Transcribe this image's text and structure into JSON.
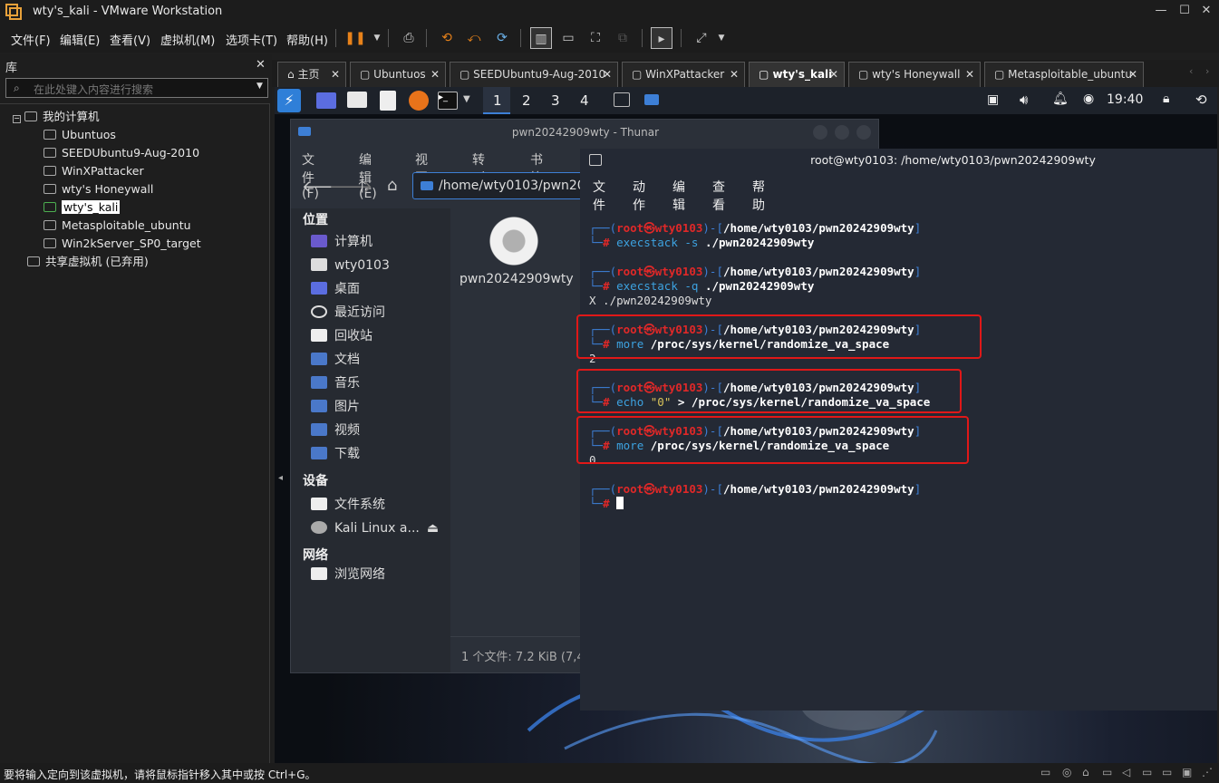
{
  "window": {
    "title": "wty's_kali - VMware Workstation",
    "min": "—",
    "max": "☐",
    "close": "✕"
  },
  "menubar": {
    "items": [
      "文件(F)",
      "编辑(E)",
      "查看(V)",
      "虚拟机(M)",
      "选项卡(T)",
      "帮助(H)"
    ]
  },
  "library": {
    "title": "库",
    "close": "✕",
    "search_placeholder": "在此处键入内容进行搜索",
    "root": "我的计算机",
    "vms": [
      "Ubuntuos",
      "SEEDUbuntu9-Aug-2010",
      "WinXPattacker",
      "wty's Honeywall",
      "wty's_kali",
      "Metasploitable_ubuntu",
      "Win2kServer_SP0_target"
    ],
    "selected": "wty's_kali",
    "shared": "共享虚拟机 (已弃用)"
  },
  "tabs": [
    {
      "label": "主页"
    },
    {
      "label": "Ubuntuos"
    },
    {
      "label": "SEEDUbuntu9-Aug-2010"
    },
    {
      "label": "WinXPattacker"
    },
    {
      "label": "wty's_kali",
      "active": true
    },
    {
      "label": "wty's Honeywall"
    },
    {
      "label": "Metasploitable_ubuntu"
    }
  ],
  "kali": {
    "workspaces": [
      "1",
      "2",
      "3",
      "4"
    ],
    "clock": "19:40",
    "desktop_icon": "Firefox ESR"
  },
  "thunar": {
    "title": "pwn20242909wty - Thunar",
    "menu": [
      "文件(F)",
      "编辑(E)",
      "视图(V)",
      "转到(G)",
      "书签(B)"
    ],
    "path": "/home/wty0103/pwn202",
    "sections": {
      "places": "位置",
      "devices": "设备",
      "network": "网络"
    },
    "places": [
      "计算机",
      "wty0103",
      "桌面",
      "最近访问",
      "回收站",
      "文档",
      "音乐",
      "图片",
      "视频",
      "下载"
    ],
    "devices": [
      "文件系统",
      "Kali Linux a..."
    ],
    "network_items": [
      "浏览网络"
    ],
    "file": "pwn20242909wty",
    "status": "1 个文件: 7.2 KiB (7,4"
  },
  "terminal": {
    "title": "root@wty0103: /home/wty0103/pwn20242909wty",
    "menu": [
      "文件",
      "动作",
      "编辑",
      "查看",
      "帮助"
    ],
    "user": "root",
    "host": "wty0103",
    "cwd": "/home/wty0103/pwn20242909wty",
    "blocks": [
      {
        "cmd": "execstack",
        "args": "-s",
        "target": "./pwn20242909wty",
        "output": ""
      },
      {
        "cmd": "execstack",
        "args": "-q",
        "target": "./pwn20242909wty",
        "output": "X ./pwn20242909wty"
      },
      {
        "cmd": "more",
        "args": "",
        "target": "/proc/sys/kernel/randomize_va_space",
        "output": "2"
      },
      {
        "cmd": "echo",
        "args": "\"0\"",
        "target": "> /proc/sys/kernel/randomize_va_space",
        "output": ""
      },
      {
        "cmd": "more",
        "args": "",
        "target": "/proc/sys/kernel/randomize_va_space",
        "output": "0"
      }
    ]
  },
  "statusbar": {
    "text": "要将输入定向到该虚拟机，请将鼠标指针移入其中或按 Ctrl+G。"
  },
  "colors": {
    "prompt_root": "#e02828",
    "prompt_frame": "#3d7fd6",
    "highlight_box": "#e01818",
    "accent": "#3d7fd6"
  }
}
